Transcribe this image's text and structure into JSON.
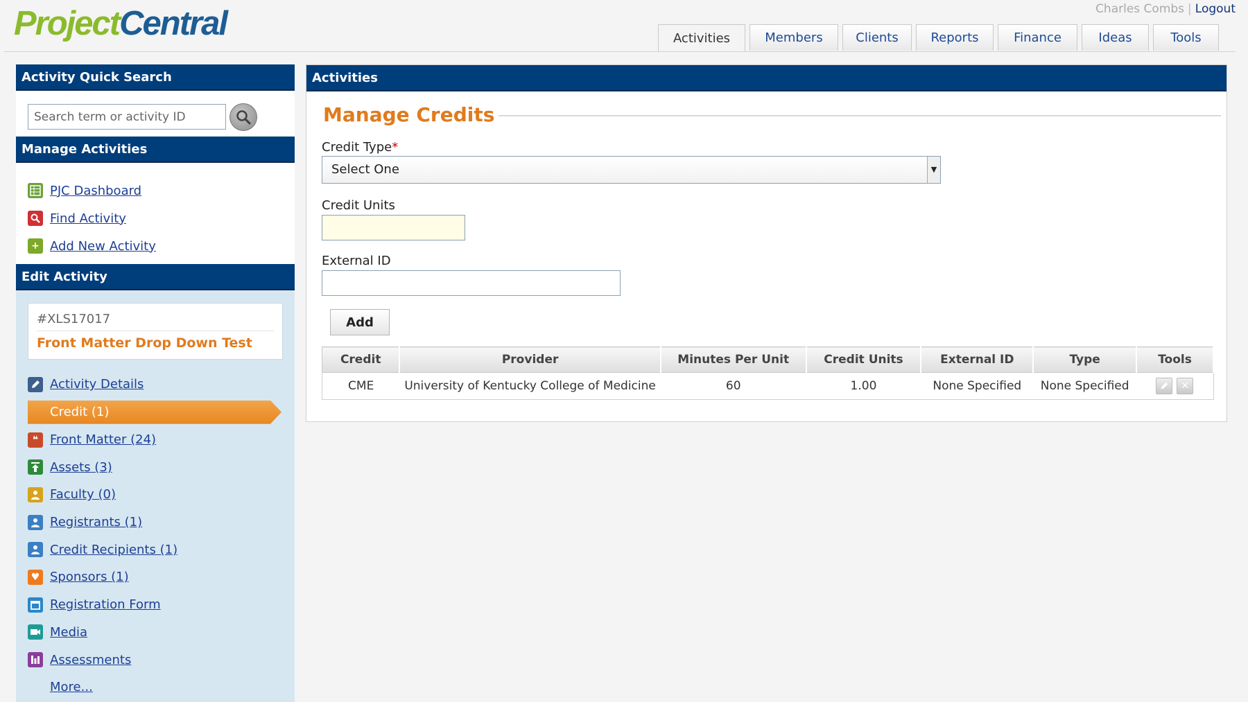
{
  "app": {
    "logo_part1": "Project",
    "logo_part2": "Central"
  },
  "user": {
    "name": "Charles Combs",
    "separator": "|",
    "logout": "Logout"
  },
  "tabs": [
    {
      "label": "Activities",
      "active": true
    },
    {
      "label": "Members"
    },
    {
      "label": "Clients"
    },
    {
      "label": "Reports"
    },
    {
      "label": "Finance"
    },
    {
      "label": "Ideas"
    },
    {
      "label": "Tools"
    }
  ],
  "sidebar": {
    "quick_search_title": "Activity Quick Search",
    "search_placeholder": "Search term or activity ID",
    "manage_title": "Manage Activities",
    "manage_items": [
      {
        "label": "PJC Dashboard",
        "icon": "dashboard-icon",
        "color": "#6ea23a"
      },
      {
        "label": "Find Activity",
        "icon": "find-icon",
        "color": "#cf3034"
      },
      {
        "label": "Add New Activity",
        "icon": "add-icon",
        "color": "#7da828"
      }
    ],
    "edit_title": "Edit Activity",
    "activity_id": "#XLS17017",
    "activity_name": "Front Matter Drop Down Test",
    "edit_items": [
      {
        "label": "Activity Details",
        "icon": "edit-icon",
        "color": "#3d5f8d"
      },
      {
        "label": "Credit (1)",
        "active": true
      },
      {
        "label": "Front Matter (24)",
        "icon": "quote-icon",
        "color": "#c94a2a"
      },
      {
        "label": "Assets (3)",
        "icon": "upload-icon",
        "color": "#2e8a39"
      },
      {
        "label": "Faculty (0)",
        "icon": "person-icon",
        "color": "#d7a21d"
      },
      {
        "label": "Registrants (1)",
        "icon": "person-icon",
        "color": "#3b7fc4"
      },
      {
        "label": "Credit Recipients (1)",
        "icon": "person-icon",
        "color": "#3b7fc4"
      },
      {
        "label": "Sponsors (1)",
        "icon": "heart-icon",
        "color": "#ef7a1c"
      },
      {
        "label": "Registration Form",
        "icon": "form-icon",
        "color": "#2b87c9"
      },
      {
        "label": "Media",
        "icon": "video-icon",
        "color": "#1f9b95"
      },
      {
        "label": "Assessments",
        "icon": "chart-icon",
        "color": "#8b3d9c"
      },
      {
        "label": "More..."
      }
    ]
  },
  "main": {
    "header": "Activities",
    "section_title": "Manage Credits",
    "credit_type_label": "Credit Type",
    "required_mark": "*",
    "credit_type_value": "Select One",
    "credit_units_label": "Credit Units",
    "external_id_label": "External ID",
    "add_label": "Add",
    "table": {
      "columns": [
        "Credit",
        "Provider",
        "Minutes Per Unit",
        "Credit Units",
        "External ID",
        "Type",
        "Tools"
      ],
      "rows": [
        {
          "credit": "CME",
          "provider": "University of Kentucky College of Medicine",
          "minutes": "60",
          "units": "1.00",
          "external_id": "None Specified",
          "type": "None Specified"
        }
      ]
    }
  }
}
